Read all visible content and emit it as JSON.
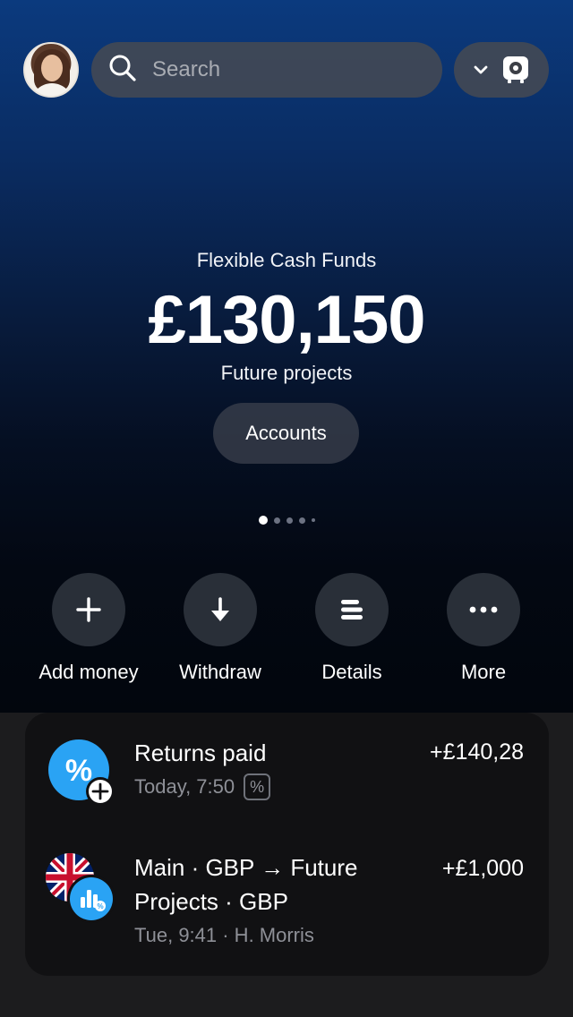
{
  "header": {
    "search_placeholder": "Search",
    "icons": [
      "avatar",
      "search-icon",
      "chevron-down-icon",
      "account-icon"
    ]
  },
  "balance": {
    "label": "Flexible Cash Funds",
    "amount": "£130,150",
    "subtitle": "Future projects",
    "accounts_button": "Accounts"
  },
  "pager": {
    "count": 5,
    "active_index": 0
  },
  "actions": [
    {
      "label": "Add money",
      "icon": "plus-icon"
    },
    {
      "label": "Withdraw",
      "icon": "arrow-down-icon"
    },
    {
      "label": "Details",
      "icon": "details-icon"
    },
    {
      "label": "More",
      "icon": "more-icon"
    }
  ],
  "transactions": [
    {
      "title": "Returns paid",
      "meta": "Today, 7:50",
      "badge": "%",
      "amount": "+£140,28",
      "icon": "percent-icon"
    },
    {
      "title": "Main · GBP → Future Projects · GBP",
      "meta": "Tue, 9:41 · H. Morris",
      "amount": "+£1,000",
      "icon": "uk-flag-icon"
    }
  ],
  "colors": {
    "accent": "#2aa3f4",
    "hero_top": "#0b3a7e",
    "hero_bottom": "#02060d",
    "card_bg": "#111113",
    "muted_text": "#8e9097"
  }
}
